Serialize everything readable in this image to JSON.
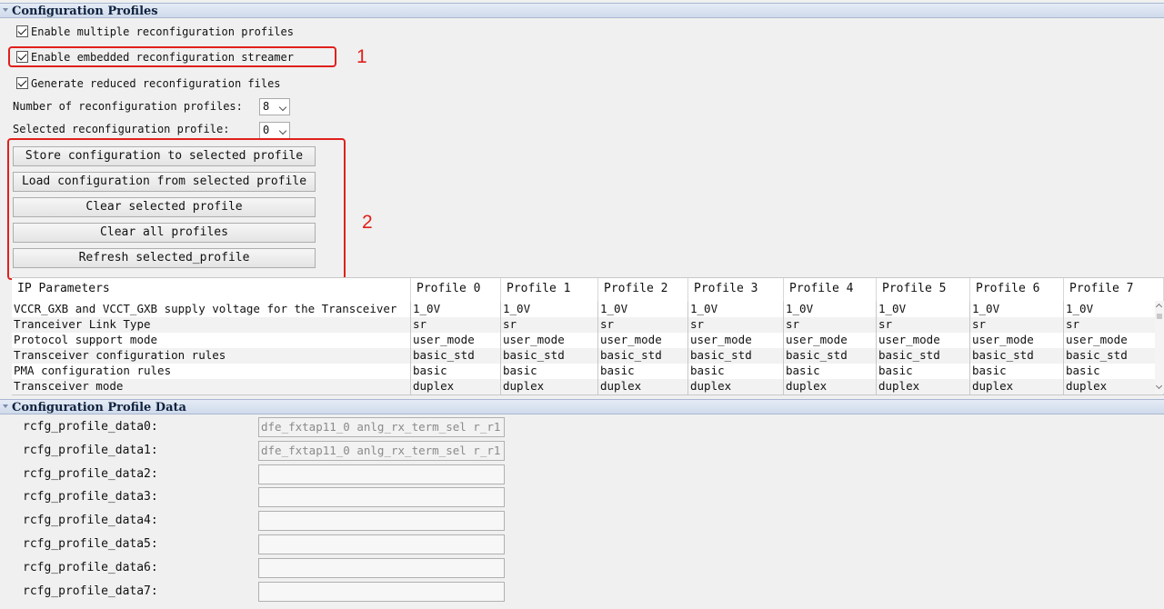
{
  "config_profiles": {
    "header": "Configuration Profiles",
    "enable_multiple": "Enable multiple reconfiguration profiles",
    "enable_streamer": "Enable embedded reconfiguration streamer",
    "generate_reduced": "Generate reduced reconfiguration files",
    "num_profiles_label": "Number of reconfiguration profiles:",
    "num_profiles_value": "8",
    "selected_profile_label": "Selected reconfiguration profile:",
    "selected_profile_value": "0",
    "buttons": {
      "store": "Store configuration to selected profile",
      "load": "Load configuration from selected profile",
      "clear_selected": "Clear selected profile",
      "clear_all": "Clear all profiles",
      "refresh": "Refresh selected_profile"
    },
    "annotation_1": "1",
    "annotation_2": "2"
  },
  "table": {
    "headers": [
      "IP Parameters",
      "Profile 0",
      "Profile 1",
      "Profile 2",
      "Profile 3",
      "Profile 4",
      "Profile 5",
      "Profile 6",
      "Profile 7"
    ],
    "rows": [
      {
        "param": "VCCR_GXB and VCCT_GXB supply voltage for the Transceiver",
        "values": [
          "1_0V",
          "1_0V",
          "1_0V",
          "1_0V",
          "1_0V",
          "1_0V",
          "1_0V",
          "1_0V"
        ]
      },
      {
        "param": "Tranceiver Link Type",
        "values": [
          "sr",
          "sr",
          "sr",
          "sr",
          "sr",
          "sr",
          "sr",
          "sr"
        ]
      },
      {
        "param": "Protocol support mode",
        "values": [
          "user_mode",
          "user_mode",
          "user_mode",
          "user_mode",
          "user_mode",
          "user_mode",
          "user_mode",
          "user_mode"
        ]
      },
      {
        "param": "Transceiver configuration rules",
        "values": [
          "basic_std",
          "basic_std",
          "basic_std",
          "basic_std",
          "basic_std",
          "basic_std",
          "basic_std",
          "basic_std"
        ]
      },
      {
        "param": "PMA configuration rules",
        "values": [
          "basic",
          "basic",
          "basic",
          "basic",
          "basic",
          "basic",
          "basic",
          "basic"
        ]
      },
      {
        "param": "Transceiver mode",
        "values": [
          "duplex",
          "duplex",
          "duplex",
          "duplex",
          "duplex",
          "duplex",
          "duplex",
          "duplex"
        ]
      }
    ]
  },
  "profile_data": {
    "header": "Configuration Profile Data",
    "items": [
      {
        "label": "rcfg_profile_data0:",
        "value": "dfe_fxtap11_0 anlg_rx_term_sel r_r1"
      },
      {
        "label": "rcfg_profile_data1:",
        "value": "dfe_fxtap11_0 anlg_rx_term_sel r_r1"
      },
      {
        "label": "rcfg_profile_data2:",
        "value": ""
      },
      {
        "label": "rcfg_profile_data3:",
        "value": ""
      },
      {
        "label": "rcfg_profile_data4:",
        "value": ""
      },
      {
        "label": "rcfg_profile_data5:",
        "value": ""
      },
      {
        "label": "rcfg_profile_data6:",
        "value": ""
      },
      {
        "label": "rcfg_profile_data7:",
        "value": ""
      }
    ]
  },
  "colors": {
    "annotation_red": "#e0201b",
    "header_blue": "#cfdaeb"
  }
}
